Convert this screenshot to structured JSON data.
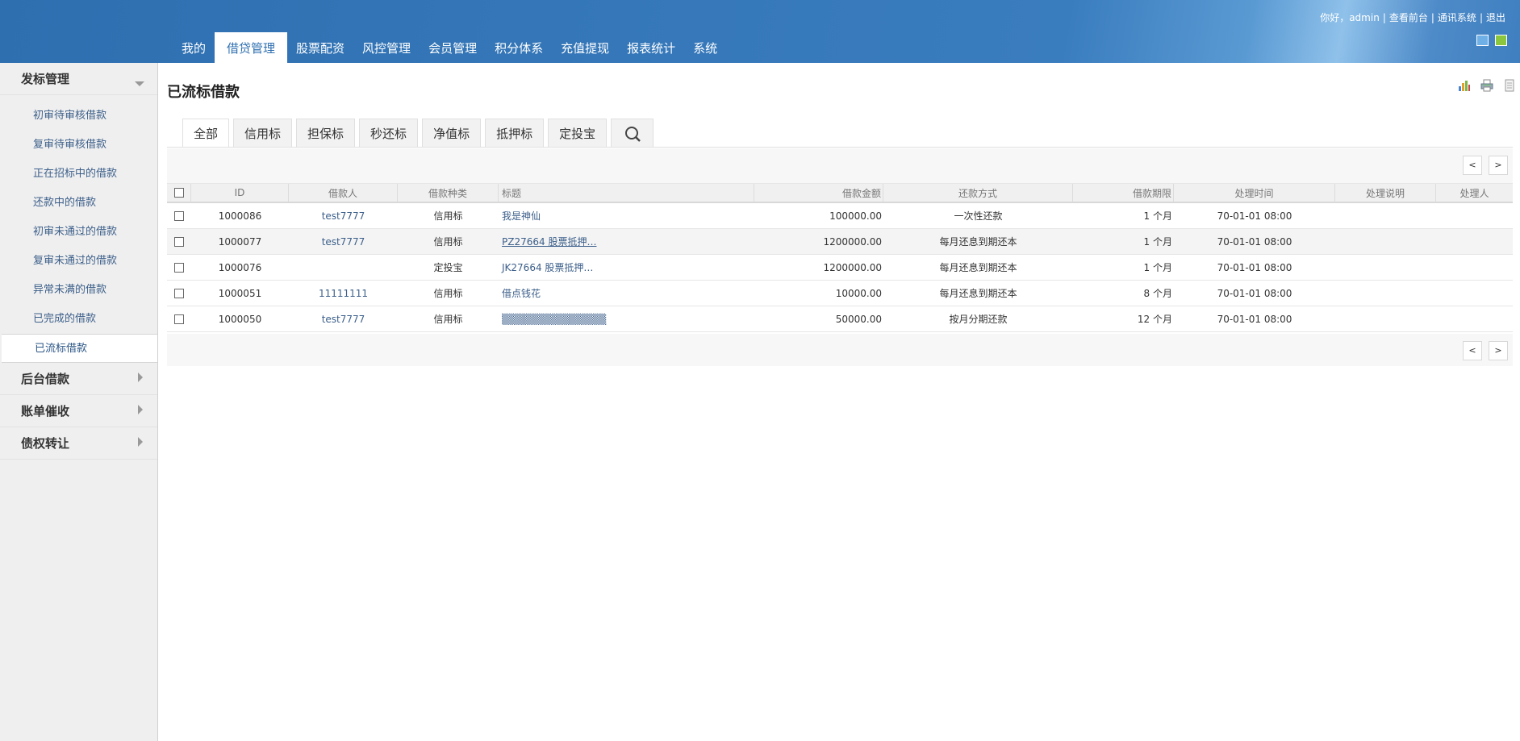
{
  "header": {
    "greeting": "你好，admin",
    "links": [
      "查看前台",
      "通讯系统",
      "退出"
    ],
    "separator": "|",
    "skin_colors": [
      "#6fb0e6",
      "#8cc63e"
    ]
  },
  "nav": {
    "items": [
      "我的",
      "借贷管理",
      "股票配资",
      "风控管理",
      "会员管理",
      "积分体系",
      "充值提现",
      "报表统计",
      "系统"
    ],
    "active_index": 1
  },
  "sidebar": {
    "group1": {
      "title": "发标管理",
      "items": [
        "初审待审核借款",
        "复审待审核借款",
        "正在招标中的借款",
        "还款中的借款",
        "初审未通过的借款",
        "复审未通过的借款",
        "异常未满的借款",
        "已完成的借款",
        "已流标借款"
      ],
      "active_index": 8
    },
    "groups": [
      "后台借款",
      "账单催收",
      "债权转让"
    ]
  },
  "main": {
    "title": "已流标借款",
    "tool_icons": [
      "chart-icon",
      "print-icon",
      "export-icon"
    ],
    "tabs": [
      "全部",
      "信用标",
      "担保标",
      "秒还标",
      "净值标",
      "抵押标",
      "定投宝"
    ],
    "active_tab": 0,
    "pager": {
      "prev": "<",
      "next": ">"
    }
  },
  "table": {
    "headers": [
      "ID",
      "借款人",
      "借款种类",
      "标题",
      "借款金额",
      "还款方式",
      "借款期限",
      "处理时间",
      "处理说明",
      "处理人"
    ],
    "rows": [
      {
        "id": "1000086",
        "borrower": "test7777",
        "type": "信用标",
        "title": "我是神仙",
        "amount": "100000.00",
        "repay": "一次性还款",
        "term": "1 个月",
        "time": "70-01-01 08:00",
        "note": "",
        "handler": ""
      },
      {
        "id": "1000077",
        "borrower": "test7777",
        "type": "信用标",
        "title": "PZ27664 股票抵押…",
        "amount": "1200000.00",
        "repay": "每月还息到期还本",
        "term": "1 个月",
        "time": "70-01-01 08:00",
        "note": "",
        "handler": ""
      },
      {
        "id": "1000076",
        "borrower": "",
        "type": "定投宝",
        "title": "JK27664 股票抵押…",
        "amount": "1200000.00",
        "repay": "每月还息到期还本",
        "term": "1 个月",
        "time": "70-01-01 08:00",
        "note": "",
        "handler": ""
      },
      {
        "id": "1000051",
        "borrower": "11111111",
        "type": "信用标",
        "title": "借点钱花",
        "amount": "10000.00",
        "repay": "每月还息到期还本",
        "term": "8 个月",
        "time": "70-01-01 08:00",
        "note": "",
        "handler": ""
      },
      {
        "id": "1000050",
        "borrower": "test7777",
        "type": "信用标",
        "title": "▒▒▒▒▒▒▒▒▒▒▒▒▒▒",
        "amount": "50000.00",
        "repay": "按月分期还款",
        "term": "12 个月",
        "time": "70-01-01 08:00",
        "note": "",
        "handler": ""
      }
    ]
  }
}
